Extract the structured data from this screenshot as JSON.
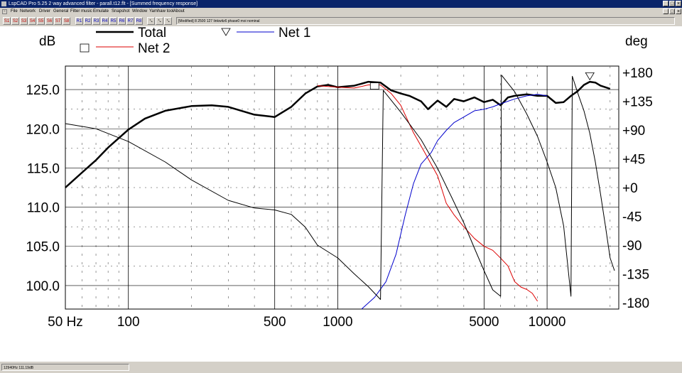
{
  "window": {
    "title": "LspCAD Pro 5.25 2 way advanced filter - parall.t12.flt - [Summed frequency response]"
  },
  "menu": {
    "items": [
      {
        "label": "File"
      },
      {
        "label": "Network"
      },
      {
        "label": "Driver"
      },
      {
        "label": "General"
      },
      {
        "label": "Filter music"
      },
      {
        "label": "Emulate"
      },
      {
        "label": "Snapshot"
      },
      {
        "label": "Window"
      },
      {
        "label": "Yamhaw tool"
      },
      {
        "label": "About"
      }
    ]
  },
  "toolbar": {
    "s_buttons": [
      "S1",
      "S2",
      "S3",
      "S4",
      "S5",
      "S6",
      "S7",
      "S8"
    ],
    "r_buttons": [
      "R1",
      "R2",
      "R3",
      "R4",
      "R5",
      "R6",
      "R7",
      "R8"
    ],
    "status_text": "[Modified] 8 2500 127 linkwitz6 phase0 moi nominal"
  },
  "statusbar": {
    "text": "12940Hz 111.19dB"
  },
  "chart_data": {
    "type": "line",
    "xscale": "log",
    "xlim": [
      50,
      22000
    ],
    "ylim_left": [
      97,
      128
    ],
    "ylim_right": [
      -190,
      190
    ],
    "grid": true,
    "left_unit": "dB",
    "right_unit": "deg",
    "x_ticks": [
      "50 Hz",
      "100",
      "500",
      "1000",
      "5000",
      "10000"
    ],
    "x_tick_values": [
      50,
      100,
      500,
      1000,
      5000,
      10000
    ],
    "y_ticks_left": [
      "100.0",
      "105.0",
      "110.0",
      "115.0",
      "120.0",
      "125.0"
    ],
    "y_tick_values_left": [
      100,
      105,
      110,
      115,
      120,
      125
    ],
    "y_ticks_right": [
      "+180",
      "+135",
      "+90",
      "+45",
      "+0",
      "-45",
      "-90",
      "-135",
      "-180"
    ],
    "y_tick_values_right": [
      180,
      135,
      90,
      45,
      0,
      -45,
      -90,
      -135,
      -180
    ],
    "legend": [
      {
        "name": "Total",
        "color": "#000000",
        "marker": "none"
      },
      {
        "name": "Net 2",
        "color": "#dd0000",
        "marker": "square"
      },
      {
        "name": "Net 1",
        "color": "#0000cc",
        "marker": "triangle"
      }
    ],
    "series": [
      {
        "name": "Total",
        "axis": "left",
        "color": "#000000",
        "width": 2.5,
        "points": [
          [
            50,
            112.5
          ],
          [
            60,
            114.4
          ],
          [
            70,
            116
          ],
          [
            80,
            117.6
          ],
          [
            100,
            119.9
          ],
          [
            120,
            121.3
          ],
          [
            150,
            122.3
          ],
          [
            200,
            122.9
          ],
          [
            250,
            123
          ],
          [
            300,
            122.8
          ],
          [
            400,
            121.8
          ],
          [
            500,
            121.5
          ],
          [
            600,
            122.8
          ],
          [
            700,
            124.5
          ],
          [
            800,
            125.4
          ],
          [
            900,
            125.6
          ],
          [
            1000,
            125.3
          ],
          [
            1200,
            125.5
          ],
          [
            1400,
            126
          ],
          [
            1600,
            125.9
          ],
          [
            1800,
            124.9
          ],
          [
            2000,
            124.5
          ],
          [
            2200,
            124.2
          ],
          [
            2500,
            123.5
          ],
          [
            2700,
            122.5
          ],
          [
            3000,
            123.6
          ],
          [
            3300,
            122.8
          ],
          [
            3600,
            123.8
          ],
          [
            4000,
            123.5
          ],
          [
            4500,
            124
          ],
          [
            5000,
            123.4
          ],
          [
            5500,
            123.7
          ],
          [
            6000,
            123
          ],
          [
            6500,
            124
          ],
          [
            7000,
            124.2
          ],
          [
            8000,
            124.4
          ],
          [
            9000,
            124.2
          ],
          [
            10000,
            124.2
          ],
          [
            11000,
            123.3
          ],
          [
            12000,
            123.4
          ],
          [
            13000,
            124.2
          ],
          [
            14000,
            124.8
          ],
          [
            15000,
            125.6
          ],
          [
            16000,
            126
          ],
          [
            17000,
            125.9
          ],
          [
            18000,
            125.5
          ],
          [
            19000,
            125.3
          ],
          [
            20000,
            125.1
          ]
        ]
      },
      {
        "name": "Net 2",
        "axis": "left",
        "color": "#dd0000",
        "width": 1,
        "points": [
          [
            800,
            125.5
          ],
          [
            1000,
            125.3
          ],
          [
            1200,
            125.2
          ],
          [
            1400,
            125.6
          ],
          [
            1600,
            125.6
          ],
          [
            1800,
            124.5
          ],
          [
            2000,
            123
          ],
          [
            2300,
            119.5
          ],
          [
            2600,
            117
          ],
          [
            3000,
            114
          ],
          [
            3300,
            110.5
          ],
          [
            3600,
            109
          ],
          [
            4000,
            107.5
          ],
          [
            4500,
            106
          ],
          [
            5000,
            105
          ],
          [
            5500,
            104.5
          ],
          [
            6000,
            103.5
          ],
          [
            6500,
            102.5
          ],
          [
            7000,
            100.5
          ],
          [
            7500,
            99.8
          ],
          [
            8000,
            99.5
          ],
          [
            8500,
            99
          ],
          [
            9000,
            98
          ]
        ]
      },
      {
        "name": "Net 1",
        "axis": "left",
        "color": "#0000cc",
        "width": 1,
        "points": [
          [
            1300,
            97
          ],
          [
            1500,
            98.5
          ],
          [
            1700,
            100.5
          ],
          [
            1900,
            104
          ],
          [
            2100,
            109
          ],
          [
            2300,
            113
          ],
          [
            2500,
            115.5
          ],
          [
            2800,
            117
          ],
          [
            3000,
            118.5
          ],
          [
            3300,
            119.8
          ],
          [
            3600,
            120.8
          ],
          [
            4000,
            121.5
          ],
          [
            4500,
            122.3
          ],
          [
            5000,
            122.5
          ],
          [
            5500,
            122.8
          ],
          [
            6000,
            123.2
          ],
          [
            7000,
            123.8
          ],
          [
            8000,
            124.2
          ],
          [
            9000,
            124.4
          ],
          [
            10000,
            124.2
          ]
        ]
      },
      {
        "name": "Phase",
        "axis": "right",
        "color": "#000000",
        "width": 1,
        "points": [
          [
            50,
            100
          ],
          [
            70,
            92
          ],
          [
            100,
            72
          ],
          [
            150,
            40
          ],
          [
            200,
            12
          ],
          [
            300,
            -20
          ],
          [
            400,
            -32
          ],
          [
            500,
            -35
          ],
          [
            600,
            -42
          ],
          [
            700,
            -62
          ],
          [
            800,
            -90
          ],
          [
            1000,
            -110
          ],
          [
            1200,
            -135
          ],
          [
            1400,
            -155
          ],
          [
            1600,
            -175
          ],
          [
            1650,
            152
          ],
          [
            2000,
            118
          ],
          [
            2500,
            75
          ],
          [
            3000,
            30
          ],
          [
            3500,
            -15
          ],
          [
            4000,
            -55
          ],
          [
            4500,
            -95
          ],
          [
            5000,
            -130
          ],
          [
            5500,
            -160
          ],
          [
            6000,
            -170
          ],
          [
            6050,
            176
          ],
          [
            7000,
            150
          ],
          [
            8000,
            115
          ],
          [
            9000,
            80
          ],
          [
            10000,
            40
          ],
          [
            11000,
            0
          ],
          [
            12000,
            -60
          ],
          [
            13000,
            -170
          ],
          [
            13200,
            174
          ],
          [
            14000,
            148
          ],
          [
            15000,
            120
          ],
          [
            16000,
            85
          ],
          [
            17000,
            40
          ],
          [
            18000,
            -10
          ],
          [
            19000,
            -60
          ],
          [
            20000,
            -110
          ],
          [
            21000,
            -130
          ]
        ]
      }
    ],
    "markers": [
      {
        "type": "square",
        "series": "Net 2",
        "x": 1500,
        "y": 125.5
      },
      {
        "type": "triangle",
        "series": "Net 1",
        "x": 16000,
        "y": 126.7
      }
    ]
  }
}
